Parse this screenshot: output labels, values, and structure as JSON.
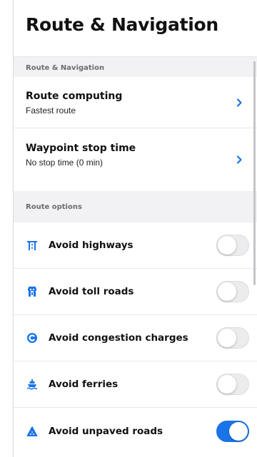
{
  "header": {
    "title": "Route & Navigation"
  },
  "sections": {
    "route_nav": {
      "label": "Route & Navigation",
      "rows": [
        {
          "title": "Route computing",
          "value": "Fastest route"
        },
        {
          "title": "Waypoint stop time",
          "value": "No stop time (0 min)"
        }
      ]
    },
    "route_options": {
      "label": "Route options",
      "toggles": [
        {
          "label": "Avoid highways",
          "on": false,
          "icon": "highway-icon"
        },
        {
          "label": "Avoid toll roads",
          "on": false,
          "icon": "toll-booth-icon"
        },
        {
          "label": "Avoid congestion charges",
          "on": false,
          "icon": "congestion-charge-icon"
        },
        {
          "label": "Avoid ferries",
          "on": false,
          "icon": "ferry-icon"
        },
        {
          "label": "Avoid unpaved roads",
          "on": true,
          "icon": "unpaved-road-icon"
        }
      ]
    }
  },
  "colors": {
    "accent": "#1a73e8",
    "section_bg": "#f2f2f4"
  }
}
